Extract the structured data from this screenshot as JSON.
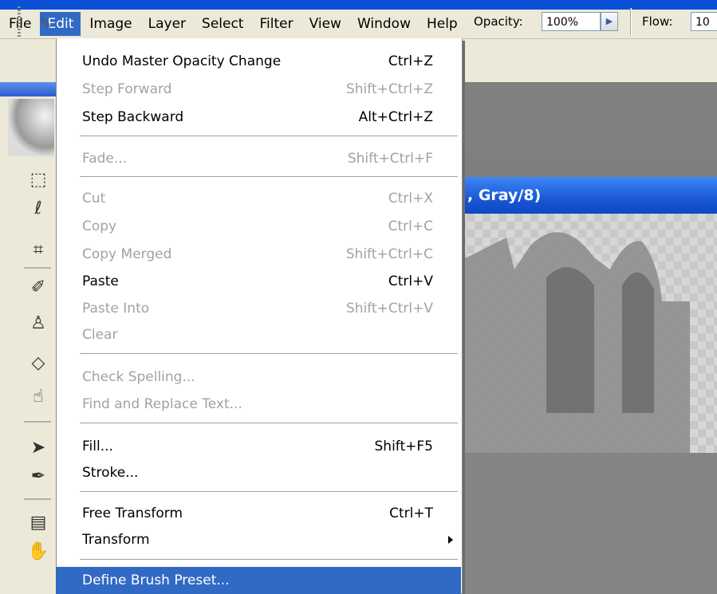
{
  "menubar": {
    "items": [
      {
        "label": "File"
      },
      {
        "label": "Edit"
      },
      {
        "label": "Image"
      },
      {
        "label": "Layer"
      },
      {
        "label": "Select"
      },
      {
        "label": "Filter"
      },
      {
        "label": "View"
      },
      {
        "label": "Window"
      },
      {
        "label": "Help"
      }
    ],
    "active_index": 1
  },
  "options": {
    "opacity_label": "Opacity:",
    "opacity_value": "100%",
    "flow_label": "Flow:",
    "flow_value": "10"
  },
  "document": {
    "title_fragment": ", Gray/8)"
  },
  "edit_menu": {
    "items": [
      {
        "label": "Undo Master Opacity Change",
        "shortcut": "Ctrl+Z",
        "enabled": true
      },
      {
        "label": "Step Forward",
        "shortcut": "Shift+Ctrl+Z",
        "enabled": false
      },
      {
        "label": "Step Backward",
        "shortcut": "Alt+Ctrl+Z",
        "enabled": true
      },
      {
        "label": "Fade...",
        "shortcut": "Shift+Ctrl+F",
        "enabled": false
      },
      {
        "label": "Cut",
        "shortcut": "Ctrl+X",
        "enabled": false
      },
      {
        "label": "Copy",
        "shortcut": "Ctrl+C",
        "enabled": false
      },
      {
        "label": "Copy Merged",
        "shortcut": "Shift+Ctrl+C",
        "enabled": false
      },
      {
        "label": "Paste",
        "shortcut": "Ctrl+V",
        "enabled": true
      },
      {
        "label": "Paste Into",
        "shortcut": "Shift+Ctrl+V",
        "enabled": false
      },
      {
        "label": "Clear",
        "shortcut": "",
        "enabled": false
      },
      {
        "label": "Check Spelling...",
        "shortcut": "",
        "enabled": false
      },
      {
        "label": "Find and Replace Text...",
        "shortcut": "",
        "enabled": false
      },
      {
        "label": "Fill...",
        "shortcut": "Shift+F5",
        "enabled": true
      },
      {
        "label": "Stroke...",
        "shortcut": "",
        "enabled": true
      },
      {
        "label": "Free Transform",
        "shortcut": "Ctrl+T",
        "enabled": true
      },
      {
        "label": "Transform",
        "shortcut": "",
        "enabled": true,
        "submenu": true
      },
      {
        "label": "Define Brush Preset...",
        "shortcut": "",
        "enabled": true,
        "highlighted": true
      }
    ]
  },
  "colors": {
    "menu_highlight": "#316ac5",
    "title_bar": "#1958d6",
    "menu_bar_bg": "#ece9d8",
    "disabled_text": "#a2a2a2"
  },
  "tools": [
    {
      "icon": "marquee-icon"
    },
    {
      "icon": "lasso-icon"
    },
    {
      "icon": "crop-icon"
    },
    {
      "icon": "healing-brush-icon"
    },
    {
      "icon": "clone-stamp-icon"
    },
    {
      "icon": "eraser-icon"
    },
    {
      "icon": "smudge-icon"
    },
    {
      "icon": "path-selection-icon"
    },
    {
      "icon": "pen-icon"
    },
    {
      "icon": "notes-icon"
    },
    {
      "icon": "hand-icon"
    }
  ]
}
